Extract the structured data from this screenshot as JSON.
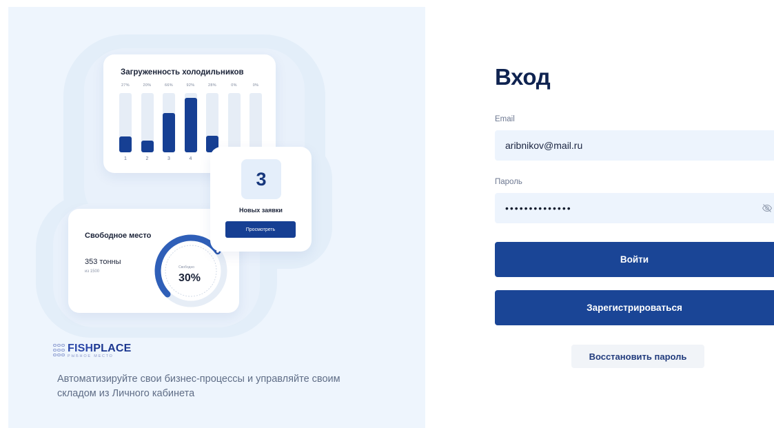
{
  "promo": {
    "chart_card": {
      "title": "Загруженность холодильников"
    },
    "requests_card": {
      "count": "3",
      "label": "Новых заявки",
      "button_label": "Просмотреть"
    },
    "free_card": {
      "title": "Свободное место",
      "value": "353 тонны",
      "of_total": "из 1500",
      "gauge_label": "Свободно",
      "gauge_value": "30%",
      "gauge_fraction": 0.7
    },
    "logo": {
      "word_part1": "FISH",
      "word_part2": "PLACE",
      "subtitle": "РЫБНОЕ МЕСТО"
    },
    "tagline": "Автоматизируйте свои бизнес-процессы и управляйте своим складом из Личного кабинета"
  },
  "chart_data": {
    "type": "bar",
    "title": "Загруженность холодильников",
    "categories": [
      "1",
      "2",
      "3",
      "4",
      "5",
      "6",
      "7"
    ],
    "value_labels": [
      "27%",
      "20%",
      "66%",
      "92%",
      "28%",
      "0%",
      "0%"
    ],
    "values": [
      27,
      20,
      66,
      92,
      28,
      0,
      0
    ],
    "ylim": [
      0,
      100
    ],
    "grid": false,
    "bar_color": "#163f93",
    "track_color": "#e6edf6"
  },
  "login": {
    "title": "Вход",
    "email_label": "Email",
    "email_value": "aribnikov@mail.ru",
    "password_label": "Пароль",
    "password_mask": "••••••••••••••",
    "login_button": "Войти",
    "register_button": "Зарегистрироваться",
    "restore_button": "Восстановить пароль"
  },
  "colors": {
    "accent": "#1a4596",
    "panel_bg": "#eef5fd",
    "field_bg": "#edf4fd"
  }
}
